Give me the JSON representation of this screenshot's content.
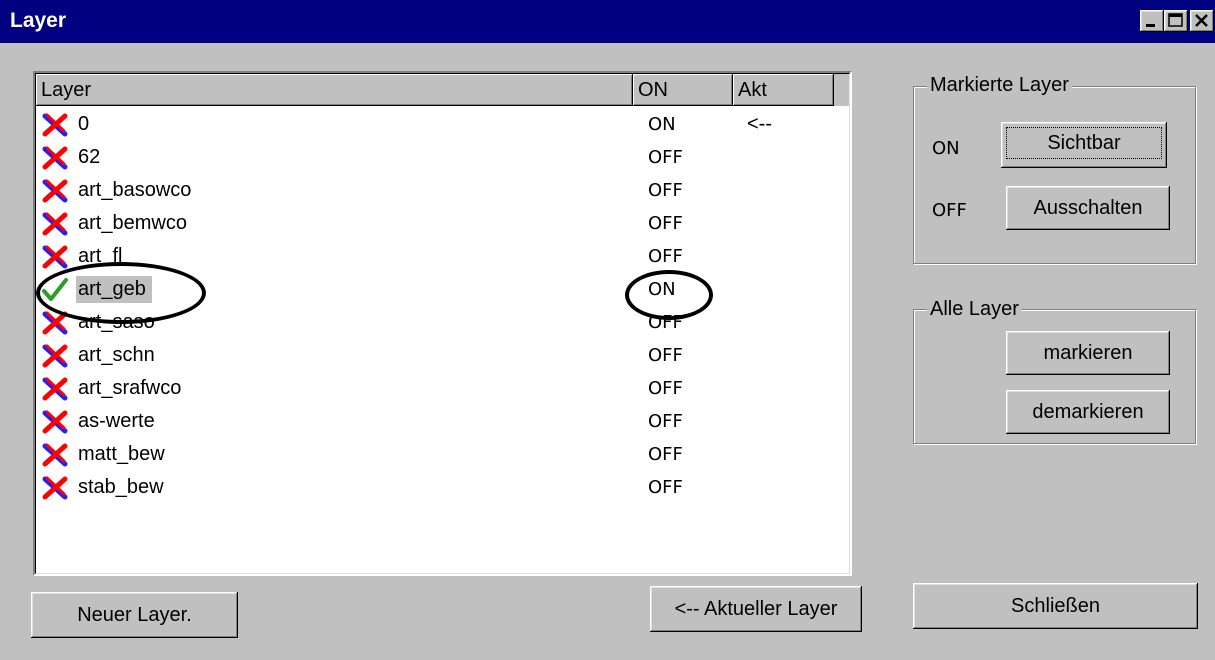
{
  "window": {
    "title": "Layer"
  },
  "list": {
    "headers": {
      "layer": "Layer",
      "on": "ON",
      "akt": "Akt"
    },
    "rows": [
      {
        "name": "0",
        "on": "ON",
        "akt": "<--",
        "icon": "red-x-icon"
      },
      {
        "name": "62",
        "on": "OFF",
        "akt": "",
        "icon": "red-x-icon"
      },
      {
        "name": "art_basowco",
        "on": "OFF",
        "akt": "",
        "icon": "red-x-icon"
      },
      {
        "name": "art_bemwco",
        "on": "OFF",
        "akt": "",
        "icon": "red-x-icon"
      },
      {
        "name": "art_fl",
        "on": "OFF",
        "akt": "",
        "icon": "red-x-icon"
      },
      {
        "name": "art_geb",
        "on": "ON",
        "akt": "",
        "icon": "green-check-icon"
      },
      {
        "name": "art_saso",
        "on": "OFF",
        "akt": "",
        "icon": "red-x-icon"
      },
      {
        "name": "art_schn",
        "on": "OFF",
        "akt": "",
        "icon": "red-x-icon"
      },
      {
        "name": "art_srafwco",
        "on": "OFF",
        "akt": "",
        "icon": "red-x-icon"
      },
      {
        "name": "as-werte",
        "on": "OFF",
        "akt": "",
        "icon": "red-x-icon"
      },
      {
        "name": "matt_bew",
        "on": "OFF",
        "akt": "",
        "icon": "red-x-icon"
      },
      {
        "name": "stab_bew",
        "on": "OFF",
        "akt": "",
        "icon": "red-x-icon"
      }
    ]
  },
  "markierte": {
    "title": "Markierte Layer",
    "on_label": "ON",
    "off_label": "OFF",
    "sichtbar": "Sichtbar",
    "ausschalten": "Ausschalten"
  },
  "alle": {
    "title": "Alle Layer",
    "markieren": "markieren",
    "demarkieren": "demarkieren"
  },
  "buttons": {
    "neuer_layer": "Neuer Layer.",
    "aktueller_layer": "<-- Aktueller Layer",
    "schliessen": "Schließen"
  },
  "colors": {
    "titlebar": "#000080",
    "face": "#c0c0c0",
    "red": "#ff0000",
    "blue": "#1f1fff",
    "green": "#2a9d2a"
  }
}
